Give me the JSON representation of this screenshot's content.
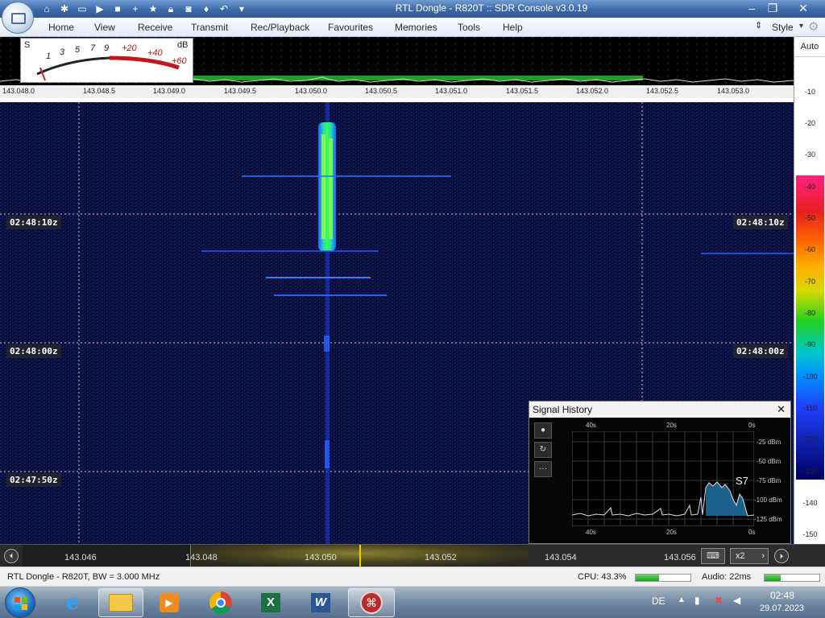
{
  "app": {
    "title": "RTL Dongle - R820T :: SDR Console v3.0.19",
    "quick_access_icons": [
      "home-icon",
      "settings-icon",
      "folder-icon",
      "play-icon",
      "stop-icon",
      "add-icon",
      "star-icon",
      "lock-icon",
      "camera-icon",
      "drop-icon",
      "undo-icon",
      "dropdown-icon"
    ]
  },
  "menu": {
    "items": [
      "Home",
      "View",
      "Receive",
      "Transmit",
      "Rec/Playback",
      "Favourites",
      "Memories",
      "Tools",
      "Help"
    ],
    "style_label": "Style"
  },
  "smeter": {
    "s_label": "S",
    "db_label": "dB",
    "s_ticks": [
      "1",
      "3",
      "5",
      "7",
      "9"
    ],
    "db_ticks": [
      "+20",
      "+40",
      "+60"
    ]
  },
  "spectrum": {
    "freq_ticks": [
      "143.048.0",
      "143.048.5",
      "143.049.0",
      "143.049.5",
      "143.050.0",
      "143.050.5",
      "143.051.0",
      "143.051.5",
      "143.052.0",
      "143.052.5",
      "143.053.0"
    ]
  },
  "db_scale": {
    "auto_label": "Auto",
    "ticks": [
      "-10",
      "-20",
      "-30",
      "-40",
      "-50",
      "-60",
      "-70",
      "-80",
      "-90",
      "-100",
      "-110",
      "-120",
      "-130",
      "-140",
      "-150"
    ]
  },
  "waterfall": {
    "timestamps": [
      "02:48:10z",
      "02:48:00z",
      "02:47:50z"
    ]
  },
  "signal_history": {
    "title": "Signal History",
    "close_label": "✕",
    "time_top": [
      "40s",
      "20s",
      "0s"
    ],
    "time_bottom": [
      "40s",
      "20s",
      "0s"
    ],
    "db_labels": [
      "-25 dBm",
      "-50 dBm",
      "-75 dBm",
      "-100 dBm",
      "-125 dBm"
    ],
    "s_reading": "S7",
    "buttons": [
      "●",
      "↻",
      "···"
    ]
  },
  "tuning": {
    "freqs": [
      "143.046",
      "143.048",
      "143.050",
      "143.052",
      "143.054",
      "143.056"
    ],
    "zoom_label": "x2"
  },
  "status": {
    "device": "RTL Dongle - R820T, BW = 3.000 MHz",
    "cpu": "CPU: 43.3%",
    "cpu_fraction": 0.433,
    "audio": "Audio: 22ms",
    "audio_fraction": 0.3
  },
  "taskbar": {
    "language": "DE",
    "time": "02:48",
    "date": "29.07.2023",
    "apps": [
      "internet-explorer-icon",
      "file-explorer-icon",
      "media-player-icon",
      "chrome-icon",
      "excel-icon",
      "word-icon",
      "sdr-console-icon"
    ]
  },
  "colors": {
    "waterfall_bg": "#0b0f3a",
    "signal_core": "#20e060",
    "signal_edge": "#2060ff",
    "accent_titlebar": "#3d6aa8"
  }
}
